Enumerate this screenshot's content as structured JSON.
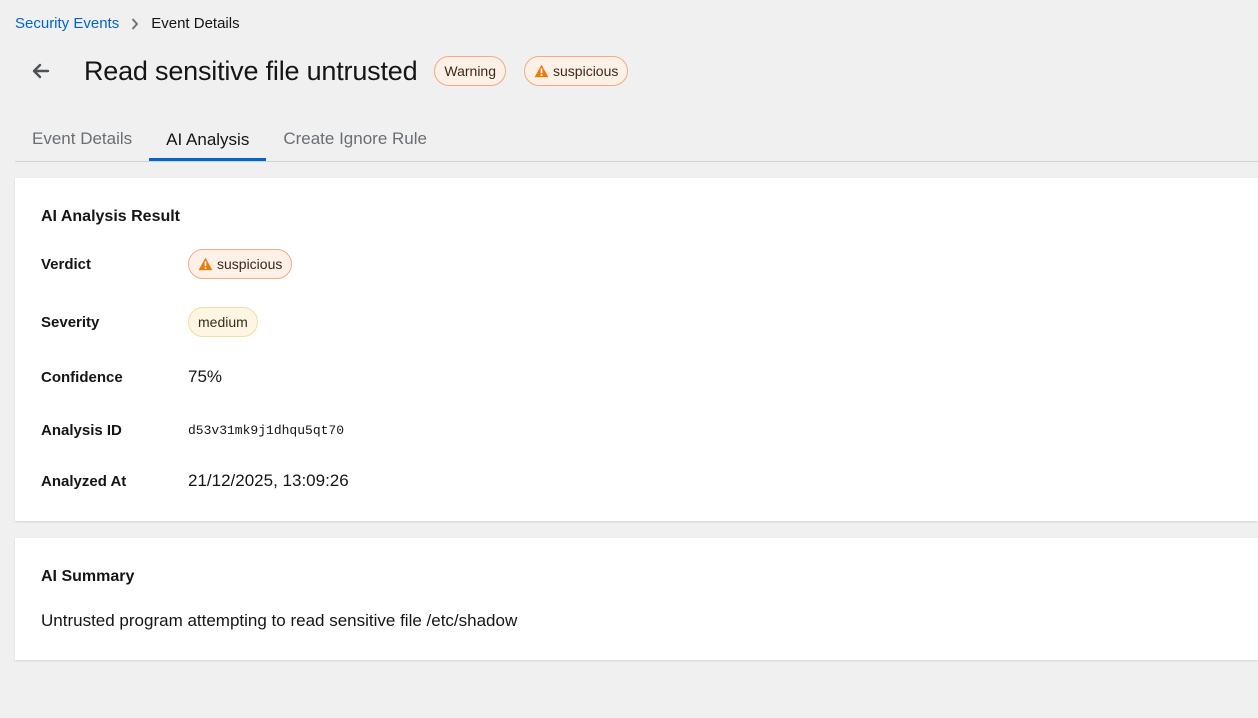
{
  "breadcrumb": {
    "parent": "Security Events",
    "current": "Event Details"
  },
  "header": {
    "title": "Read sensitive file untrusted",
    "badges": {
      "priority": "Warning",
      "verdict": "suspicious"
    }
  },
  "tabs": [
    {
      "label": "Event Details"
    },
    {
      "label": "AI Analysis"
    },
    {
      "label": "Create Ignore Rule"
    }
  ],
  "active_tab": "AI Analysis",
  "analysis_result": {
    "title": "AI Analysis Result",
    "verdict_label": "Verdict",
    "verdict_value": "suspicious",
    "severity_label": "Severity",
    "severity_value": "medium",
    "confidence_label": "Confidence",
    "confidence_value": "75%",
    "analysis_id_label": "Analysis ID",
    "analysis_id_value": "d53v31mk9j1dhqu5qt70",
    "analyzed_at_label": "Analyzed At",
    "analyzed_at_value": "21/12/2025, 13:09:26"
  },
  "summary": {
    "title": "AI Summary",
    "text": "Untrusted program attempting to read sensitive file /etc/shadow"
  },
  "colors": {
    "link": "#0066cc",
    "tab_active": "#0066cc",
    "warning_icon": "#ec7a08",
    "badge_border": "#f0ab85",
    "badge_bg": "#fdf0e6"
  },
  "icons": {
    "breadcrumb_separator": "chevron-right-icon",
    "back": "arrow-left-icon",
    "verdict": "warning-triangle-icon"
  }
}
